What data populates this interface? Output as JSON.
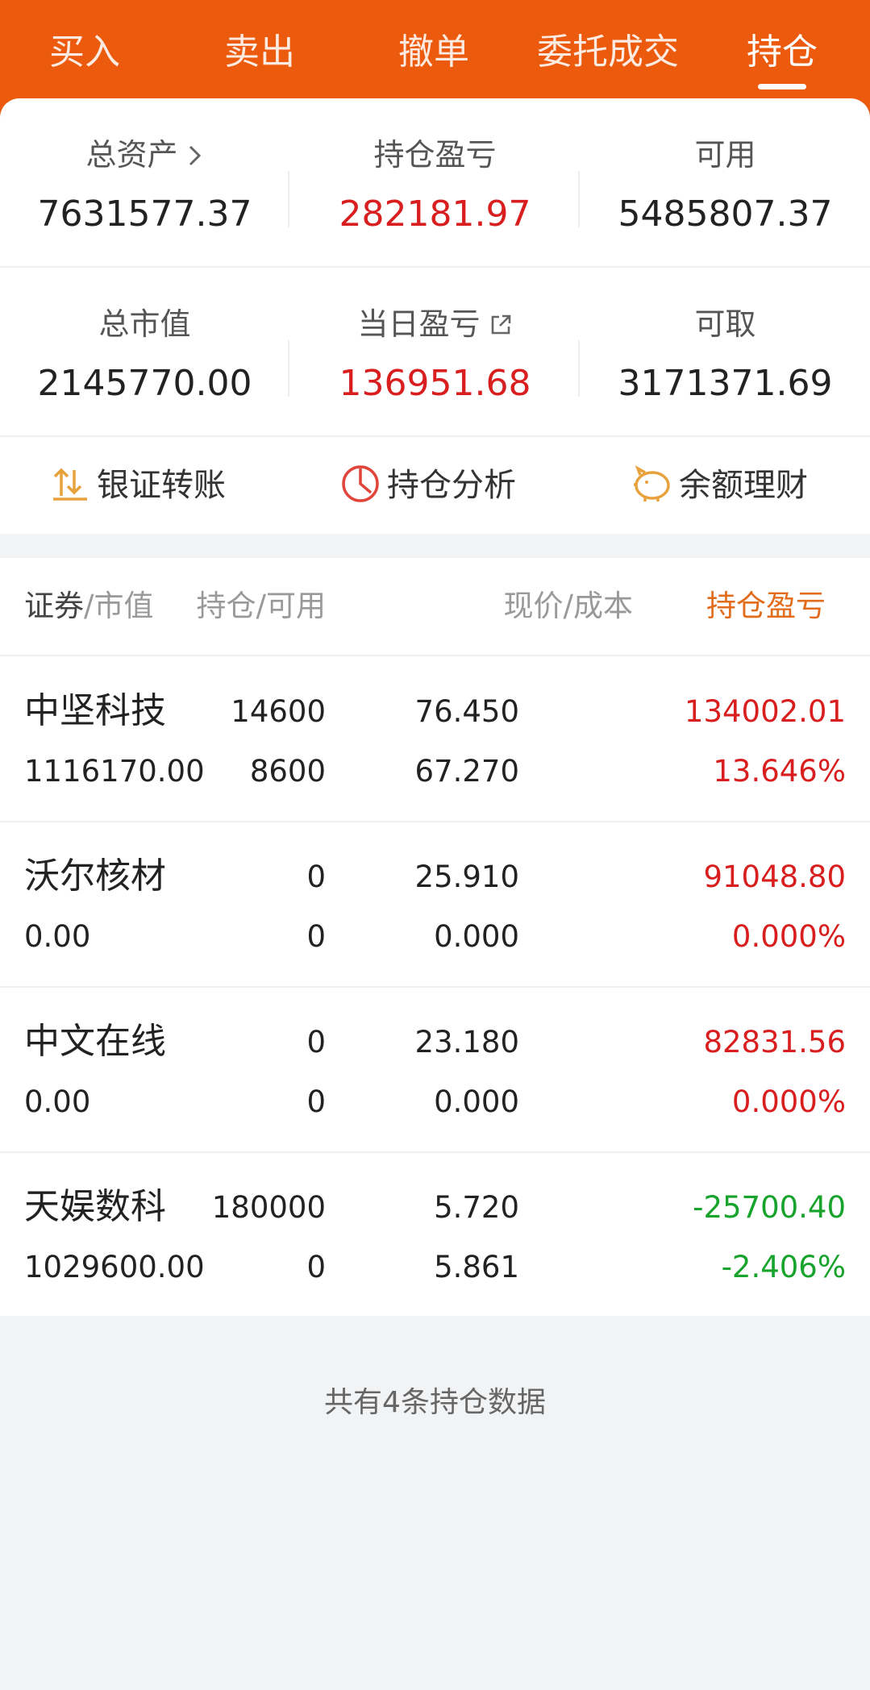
{
  "tabs": [
    "买入",
    "卖出",
    "撤单",
    "委托成交",
    "持仓"
  ],
  "active_tab": "持仓",
  "summary": {
    "total_assets": {
      "label": "总资产",
      "value": "7631577.37"
    },
    "position_pl": {
      "label": "持仓盈亏",
      "value": "282181.97"
    },
    "available": {
      "label": "可用",
      "value": "5485807.37"
    },
    "total_market_value": {
      "label": "总市值",
      "value": "2145770.00"
    },
    "daily_pl": {
      "label": "当日盈亏",
      "value": "136951.68"
    },
    "withdrawable": {
      "label": "可取",
      "value": "3171371.69"
    }
  },
  "actions": {
    "bank_transfer": "银证转账",
    "position_analysis": "持仓分析",
    "balance_finance": "余额理财"
  },
  "table": {
    "headers": {
      "security": "证券",
      "market_value": "/市值",
      "position_available": "持仓/可用",
      "price_cost": "现价/成本",
      "pl_main": "持仓盈亏",
      "pl_fade": "亏"
    },
    "rows": [
      {
        "name": "中坚科技",
        "market_value": "1116170.00",
        "position": "14600",
        "available": "8600",
        "price": "76.450",
        "cost": "67.270",
        "pl": "134002.01",
        "pl_pct": "13.646%",
        "trend": "up"
      },
      {
        "name": "沃尔核材",
        "market_value": "0.00",
        "position": "0",
        "available": "0",
        "price": "25.910",
        "cost": "0.000",
        "pl": "91048.80",
        "pl_pct": "0.000%",
        "trend": "up"
      },
      {
        "name": "中文在线",
        "market_value": "0.00",
        "position": "0",
        "available": "0",
        "price": "23.180",
        "cost": "0.000",
        "pl": "82831.56",
        "pl_pct": "0.000%",
        "trend": "up"
      },
      {
        "name": "天娱数科",
        "market_value": "1029600.00",
        "position": "180000",
        "available": "0",
        "price": "5.720",
        "cost": "5.861",
        "pl": "-25700.40",
        "pl_pct": "-2.406%",
        "trend": "down"
      }
    ]
  },
  "footer_note": "共有4条持仓数据",
  "colors": {
    "brand": "#ec5a0e",
    "profit": "#d81e1e",
    "loss": "#17a32c",
    "sort_accent": "#e26b1c"
  }
}
